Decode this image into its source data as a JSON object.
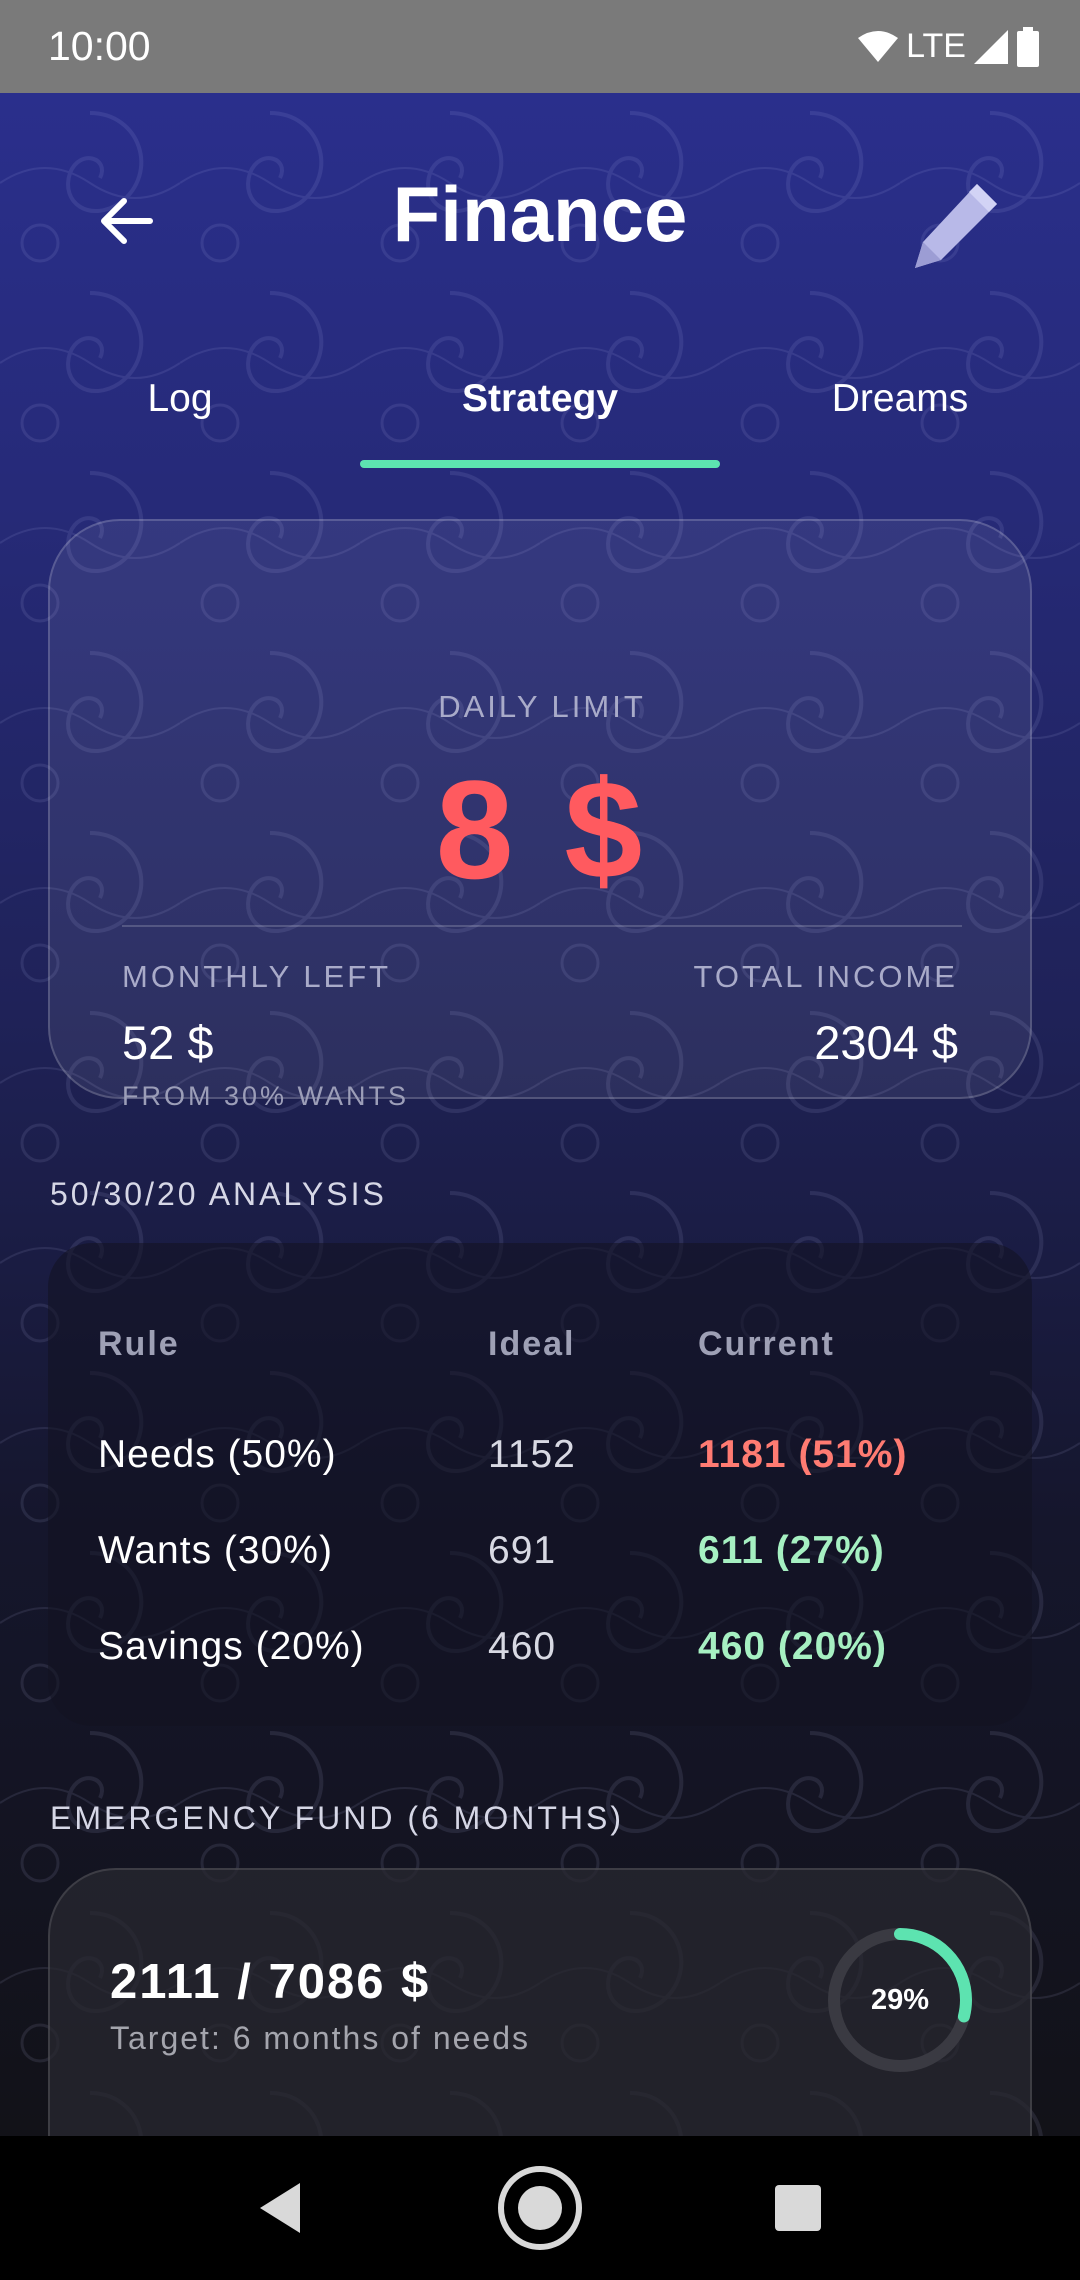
{
  "status_bar": {
    "time": "10:00",
    "network": "LTE",
    "icons": [
      "wifi-icon",
      "signal-icon",
      "battery-icon"
    ]
  },
  "header": {
    "title": "Finance",
    "back_icon": "arrow-left-icon",
    "edit_icon": "pencil-icon"
  },
  "tabs": [
    {
      "label": "Log",
      "active": false
    },
    {
      "label": "Strategy",
      "active": true
    },
    {
      "label": "Dreams",
      "active": false
    }
  ],
  "summary": {
    "daily_limit_label": "DAILY LIMIT",
    "daily_limit_value": "8 $",
    "monthly_left_label": "MONTHLY LEFT",
    "monthly_left_value": "52 $",
    "monthly_left_note": "FROM 30% WANTS",
    "total_income_label": "TOTAL INCOME",
    "total_income_value": "2304 $"
  },
  "analysis": {
    "section_title": "50/30/20 ANALYSIS",
    "headers": {
      "rule": "Rule",
      "ideal": "Ideal",
      "current": "Current"
    },
    "rows": [
      {
        "rule": "Needs (50%)",
        "ideal": "1152",
        "current": "1181 (51%)",
        "status": "over"
      },
      {
        "rule": "Wants (30%)",
        "ideal": "691",
        "current": "611 (27%)",
        "status": "ok"
      },
      {
        "rule": "Savings (20%)",
        "ideal": "460",
        "current": "460 (20%)",
        "status": "ok"
      }
    ]
  },
  "emergency": {
    "section_title": "EMERGENCY FUND (6 MONTHS)",
    "amount": "2111 / 7086 $",
    "target": "Target: 6 months of needs",
    "percent_label": "29%",
    "progress": 0.29
  },
  "colors": {
    "accent": "#5de3b0",
    "danger": "#ff5a5f",
    "over": "#ff7b72",
    "ok": "#a6f0c2"
  },
  "nav": {
    "back_icon": "triangle-back-icon",
    "home_icon": "circle-home-icon",
    "recents_icon": "square-recents-icon"
  }
}
